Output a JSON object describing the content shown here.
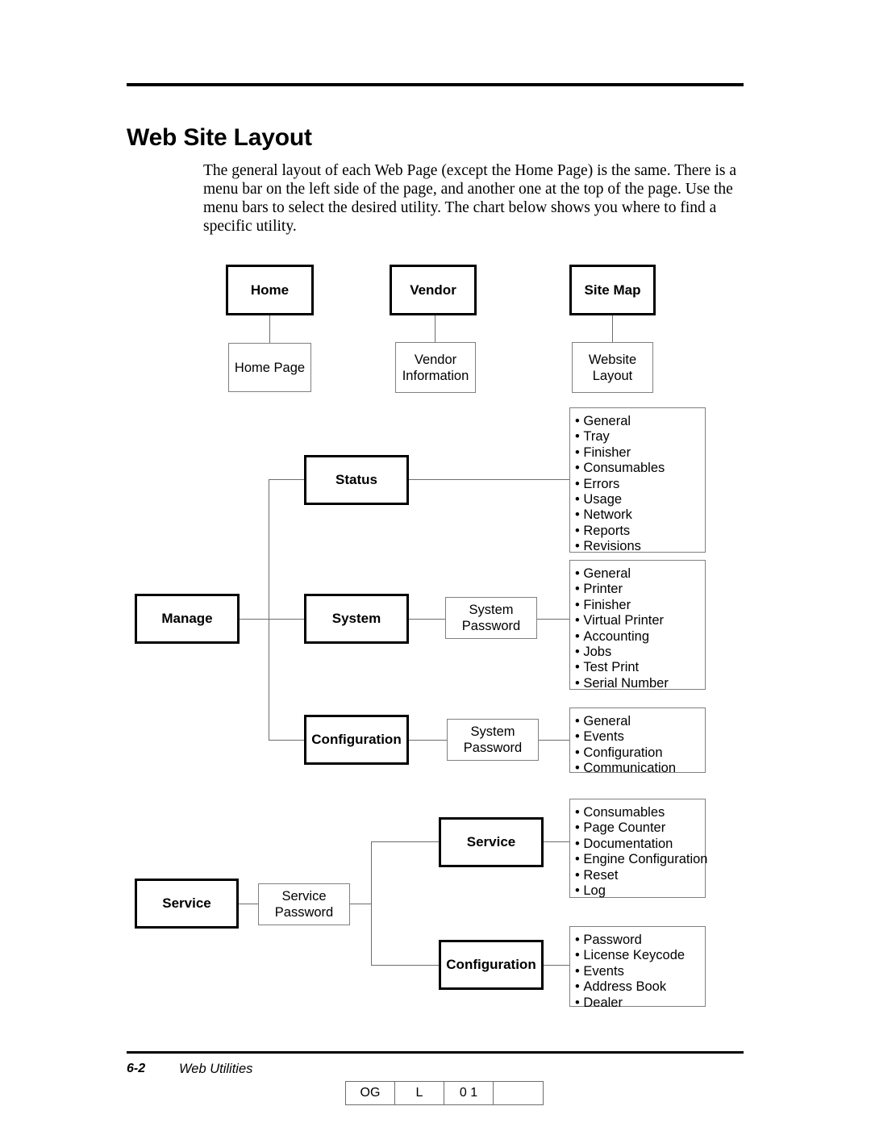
{
  "page": {
    "title": "Web Site Layout",
    "intro": "The general layout of each Web Page (except the Home Page) is the same. There is a menu bar on the left side of the page, and another one at the top of the page. Use the menu bars to select the desired utility. The chart below shows you where to find a specific utility."
  },
  "footer": {
    "page_number": "6-2",
    "section": "Web Utilities",
    "code_cells": [
      "OG",
      "L",
      "0 1",
      ""
    ]
  },
  "diagram": {
    "top_row": [
      {
        "heading": "Home",
        "child": "Home Page"
      },
      {
        "heading": "Vendor",
        "child": "Vendor Information"
      },
      {
        "heading": "Site Map",
        "child": "Website Layout"
      }
    ],
    "manage": {
      "heading": "Manage",
      "branches": [
        {
          "name": "Status",
          "gate": null,
          "items": [
            "General",
            "Tray",
            "Finisher",
            "Consumables",
            "Errors",
            "Usage",
            "Network",
            "Reports",
            "Revisions"
          ]
        },
        {
          "name": "System",
          "gate": "System Password",
          "items": [
            "General",
            "Printer",
            "Finisher",
            "Virtual Printer",
            "Accounting",
            "Jobs",
            "Test Print",
            "Serial Number"
          ]
        },
        {
          "name": "Configuration",
          "gate": "System Password",
          "items": [
            "General",
            "Events",
            "Configuration",
            "Communication"
          ]
        }
      ]
    },
    "service": {
      "heading": "Service",
      "gate": "Service Password",
      "branches": [
        {
          "name": "Service",
          "items": [
            "Consumables",
            "Page Counter",
            "Documentation",
            "Engine Configuration",
            "Reset",
            "Log"
          ]
        },
        {
          "name": "Configuration",
          "items": [
            "Password",
            "License Keycode",
            "Events",
            "Address Book",
            "Dealer"
          ]
        }
      ]
    }
  }
}
